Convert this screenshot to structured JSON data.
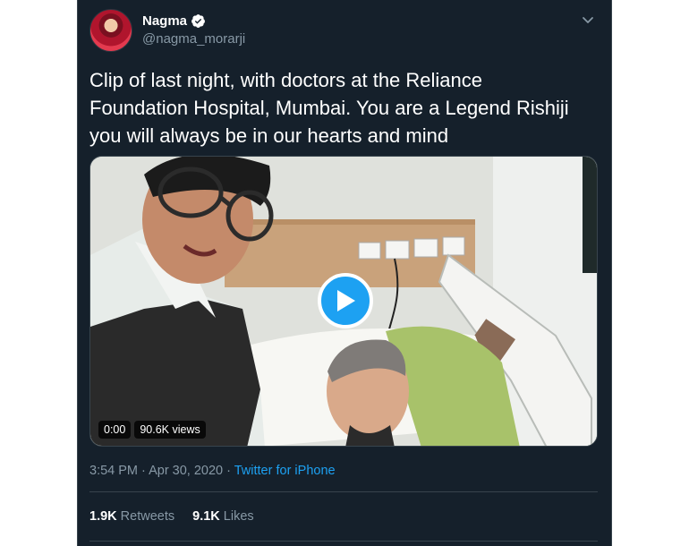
{
  "user": {
    "display_name": "Nagma",
    "handle": "@nagma_morarji",
    "verified_icon": "verified-badge-icon",
    "avatar_icon": "avatar"
  },
  "tweet": {
    "text": "Clip of last night, with doctors at the Reliance\nFoundation Hospital, Mumbai. You are a Legend Rishiji\nyou will always be in our hearts and mind"
  },
  "video": {
    "time": "0:00",
    "views": "90.6K views",
    "play_icon": "play-icon"
  },
  "meta": {
    "timestamp": "3:54 PM · Apr 30, 2020",
    "separator": " · ",
    "source": "Twitter for iPhone"
  },
  "stats": {
    "retweets_count": "1.9K",
    "retweets_label": "Retweets",
    "likes_count": "9.1K",
    "likes_label": "Likes"
  },
  "colors": {
    "background": "#15202b",
    "accent": "#1da1f2",
    "secondary_text": "#8899a6",
    "border": "#38444d"
  }
}
